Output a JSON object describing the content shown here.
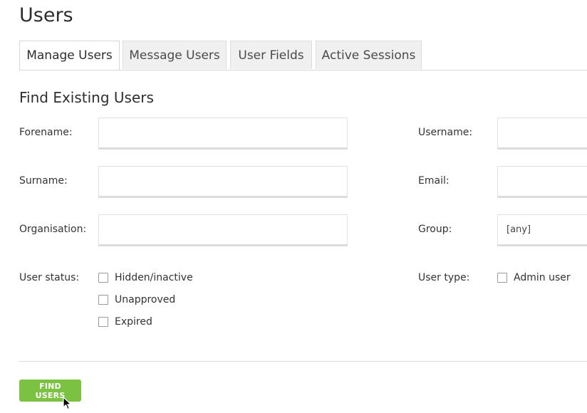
{
  "page": {
    "title": "Users"
  },
  "tabs": [
    {
      "label": "Manage Users",
      "active": true
    },
    {
      "label": "Message Users",
      "active": false
    },
    {
      "label": "User Fields",
      "active": false
    },
    {
      "label": "Active Sessions",
      "active": false
    }
  ],
  "form": {
    "title": "Find Existing Users",
    "forename": {
      "label": "Forename:",
      "value": ""
    },
    "surname": {
      "label": "Surname:",
      "value": ""
    },
    "organisation": {
      "label": "Organisation:",
      "value": ""
    },
    "username": {
      "label": "Username:",
      "value": ""
    },
    "email": {
      "label": "Email:",
      "value": ""
    },
    "group": {
      "label": "Group:",
      "value": "[any]"
    },
    "user_status": {
      "label": "User status:",
      "options": [
        {
          "label": "Hidden/inactive",
          "checked": false
        },
        {
          "label": "Unapproved",
          "checked": false
        },
        {
          "label": "Expired",
          "checked": false
        }
      ]
    },
    "user_type": {
      "label": "User type:",
      "options": [
        {
          "label": "Admin user",
          "checked": false
        }
      ]
    },
    "submit_label": "FIND USERS"
  },
  "colors": {
    "accent": "#7cc242",
    "text": "#333333",
    "tab_inactive_bg": "#f0f0f0"
  }
}
